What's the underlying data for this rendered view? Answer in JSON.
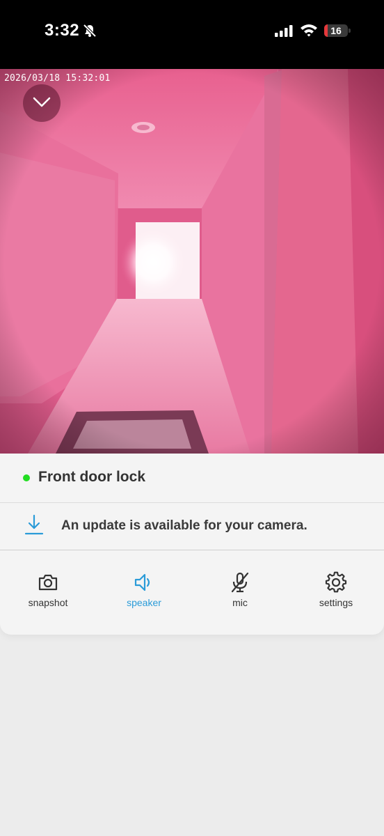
{
  "status_bar": {
    "time": "3:32",
    "battery_level": "16",
    "battery_fraction": 0.16,
    "icons": [
      "bell-slash-icon",
      "cellular-signal-icon",
      "wifi-icon",
      "battery-icon"
    ]
  },
  "camera": {
    "timestamp": "2026/03/18 15:32:01",
    "collapse_icon": "chevron-down-icon"
  },
  "device": {
    "name": "Front door lock",
    "status_color": "#22dd22"
  },
  "update": {
    "message": "An update is available for your camera.",
    "icon": "download-icon",
    "accent": "#2a9bd8"
  },
  "controls": [
    {
      "label": "snapshot",
      "icon": "camera-icon",
      "active": false
    },
    {
      "label": "speaker",
      "icon": "speaker-icon",
      "active": true
    },
    {
      "label": "mic",
      "icon": "mic-off-icon",
      "active": false
    },
    {
      "label": "settings",
      "icon": "gear-icon",
      "active": false
    }
  ]
}
